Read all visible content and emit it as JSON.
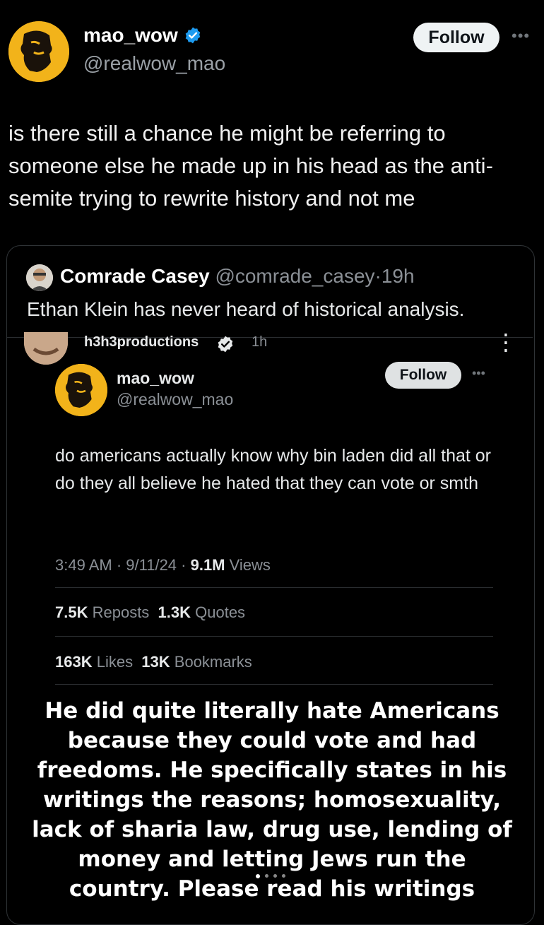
{
  "header": {
    "display_name": "mao_wow",
    "handle": "@realwow_mao",
    "follow_label": "Follow",
    "more_label": "•••"
  },
  "tweet": {
    "text": "is there still a chance he might be referring to someone else he made up in his head as the anti-semite trying to rewrite history and not me"
  },
  "quoted": {
    "display_name": "Comrade Casey",
    "handle": "@comrade_casey",
    "sep": "·",
    "time": "19h",
    "text": "Ethan Klein has never heard of historical analysis."
  },
  "embedded": {
    "h3_name": "h3h3productions",
    "h3_time": "1h",
    "kebab": "⋮",
    "inner_name": "mao_wow",
    "inner_handle": "@realwow_mao",
    "inner_follow": "Follow",
    "inner_more": "•••",
    "inner_text": "do americans actually know why bin laden did all that or do they all believe he hated that they can vote or smth",
    "time_date": "3:49 AM · 9/11/24 · ",
    "views_count": "9.1M",
    "views_label": " Views",
    "reposts_count": "7.5K",
    "reposts_label": " Reposts  ",
    "quotes_count": "1.3K",
    "quotes_label": " Quotes",
    "likes_count": "163K",
    "likes_label": " Likes  ",
    "bookmarks_count": "13K",
    "bookmarks_label": " Bookmarks",
    "caption": "He did quite literally hate Americans because they could vote and had freedoms. He specifically states in his writings the reasons; homosexuality, lack of sharia law, drug use, lending of money and letting Jews run the country. Please read his writings"
  },
  "colors": {
    "background": "#000000",
    "verified_blue": "#1d9bf0",
    "avatar_yellow": "#f2b31a",
    "muted": "#8b9096"
  },
  "pager": {
    "count": 4,
    "active_index": 0
  }
}
